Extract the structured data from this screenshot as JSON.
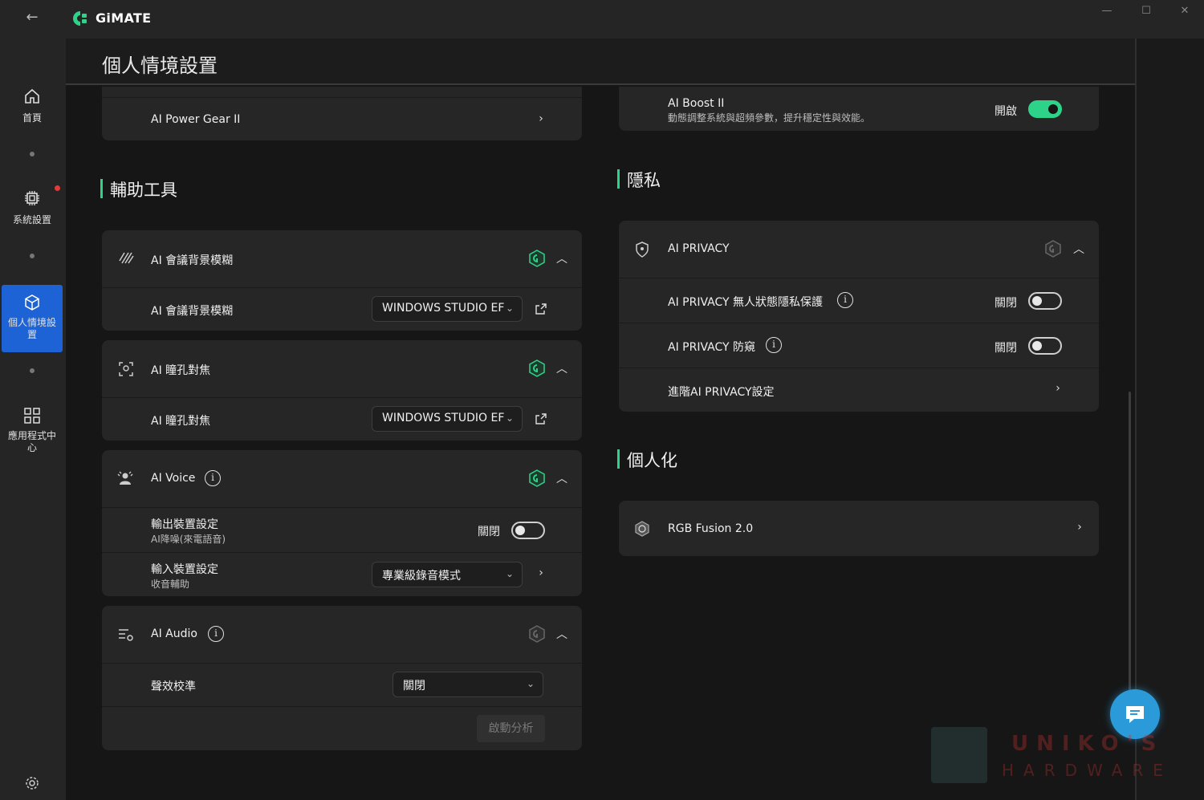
{
  "app": {
    "title": "GiMATE"
  },
  "sidebar": {
    "items": [
      {
        "label": "首頁",
        "icon": "home-icon"
      },
      {
        "label": "系統設置",
        "icon": "chip-icon"
      },
      {
        "label": "個人情境設置",
        "icon": "cube-icon",
        "active": true
      },
      {
        "label": "應用程式中心",
        "icon": "grid-icon"
      }
    ]
  },
  "header": {
    "title": "個人情境設置"
  },
  "left": {
    "power_gear": {
      "label": "AI Power Gear II"
    },
    "section_title": "輔助工具",
    "bg_blur": {
      "header": "AI 會議背景模糊",
      "row_label": "AI 會議背景模糊",
      "select_value": "WINDOWS STUDIO EF"
    },
    "eye": {
      "header": "AI 瞳孔對焦",
      "row_label": "AI 瞳孔對焦",
      "select_value": "WINDOWS STUDIO EF"
    },
    "voice": {
      "header": "AI Voice",
      "output_label": "輸出裝置設定",
      "output_sub": "AI降噪(來電語音)",
      "output_state": "關閉",
      "input_label": "輸入裝置設定",
      "input_sub": "收音輔助",
      "input_select": "專業級錄音模式"
    },
    "audio": {
      "header": "AI Audio",
      "calib_label": "聲效校準",
      "calib_select": "關閉",
      "analyze_button": "啟動分析"
    }
  },
  "right": {
    "boost": {
      "label": "AI Boost II",
      "sub": "動態調整系統與超頻參數，提升穩定性與效能。",
      "state": "開啟"
    },
    "privacy_section": "隱私",
    "privacy": {
      "header": "AI PRIVACY",
      "row1_label": "AI PRIVACY 無人狀態隱私保護",
      "row1_state": "關閉",
      "row2_label": "AI PRIVACY 防窺",
      "row2_state": "關閉",
      "advanced_label": "進階AI PRIVACY設定"
    },
    "personal_section": "個人化",
    "rgb": {
      "label": "RGB Fusion 2.0"
    }
  },
  "watermark": {
    "line1": "UNIKO'S",
    "line2": "HARDWARE"
  },
  "colors": {
    "accent": "#2ed38a",
    "active_nav": "#1e63d6",
    "fab": "#2a9bd8"
  }
}
